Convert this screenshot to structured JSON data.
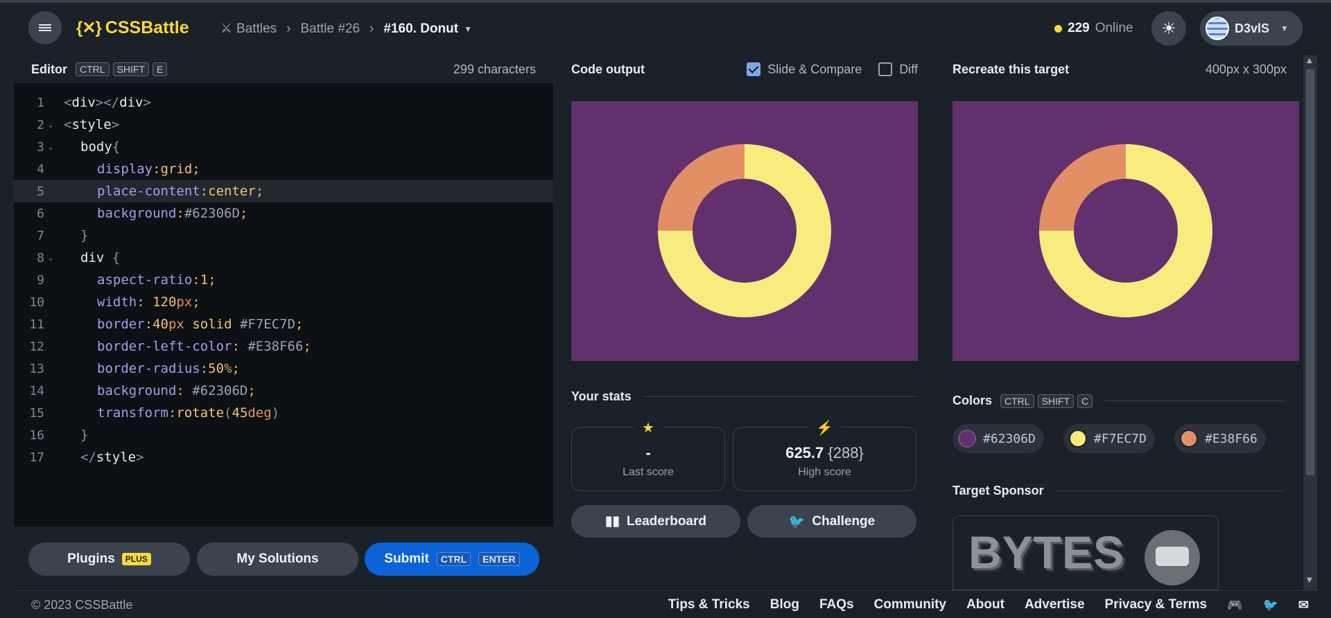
{
  "header": {
    "logo_icon": "{✕}",
    "logo_text": "CSSBattle",
    "breadcrumbs": [
      {
        "label": "Battles"
      },
      {
        "label": "Battle #26"
      },
      {
        "label": "#160. Donut"
      }
    ],
    "online_count": "229",
    "online_label": "Online",
    "username": "D3vlS"
  },
  "editor": {
    "title": "Editor",
    "shortcut": [
      "CTRL",
      "SHIFT",
      "E"
    ],
    "char_count": "299 characters",
    "lines": [
      {
        "n": "1",
        "fold": ""
      },
      {
        "n": "2",
        "fold": "⌄"
      },
      {
        "n": "3",
        "fold": "⌄"
      },
      {
        "n": "4",
        "fold": ""
      },
      {
        "n": "5",
        "fold": ""
      },
      {
        "n": "6",
        "fold": ""
      },
      {
        "n": "7",
        "fold": ""
      },
      {
        "n": "8",
        "fold": "⌄"
      },
      {
        "n": "9",
        "fold": ""
      },
      {
        "n": "10",
        "fold": ""
      },
      {
        "n": "11",
        "fold": ""
      },
      {
        "n": "12",
        "fold": ""
      },
      {
        "n": "13",
        "fold": ""
      },
      {
        "n": "14",
        "fold": ""
      },
      {
        "n": "15",
        "fold": ""
      },
      {
        "n": "16",
        "fold": ""
      },
      {
        "n": "17",
        "fold": ""
      }
    ],
    "code": {
      "l1": [
        "<",
        "div",
        "></",
        "div",
        ">"
      ],
      "l2": [
        "<",
        "style",
        ">"
      ],
      "l3": [
        "body",
        "{"
      ],
      "l4": [
        "display",
        ":",
        "grid",
        ";"
      ],
      "l5": [
        "place-content",
        ":",
        "center",
        ";"
      ],
      "l6": [
        "background",
        ":",
        "#62306D",
        ";"
      ],
      "l7": [
        "}"
      ],
      "l8": [
        "div",
        " {"
      ],
      "l9": [
        "aspect-ratio",
        ":",
        "1",
        ";"
      ],
      "l10": [
        "width",
        ": ",
        "120",
        "px",
        ";"
      ],
      "l11": [
        "border",
        ":",
        "40",
        "px",
        " solid ",
        "#F7EC7D",
        ";"
      ],
      "l12": [
        "border-left-color",
        ": ",
        "#E38F66",
        ";"
      ],
      "l13": [
        "border-radius",
        ":",
        "50",
        "%",
        ";"
      ],
      "l14": [
        "background",
        ": ",
        "#62306D",
        ";"
      ],
      "l15": [
        "transform",
        ":",
        "rotate",
        "(",
        "45",
        "deg",
        ")"
      ],
      "l16": [
        "}"
      ],
      "l17": [
        "</",
        "style",
        ">"
      ]
    },
    "plugins_label": "Plugins",
    "plugins_badge": "PLUS",
    "solutions_label": "My Solutions",
    "submit_label": "Submit",
    "submit_keys": [
      "CTRL",
      "ENTER"
    ]
  },
  "output": {
    "title": "Code output",
    "slide_compare_label": "Slide & Compare",
    "slide_compare_checked": true,
    "diff_label": "Diff",
    "diff_checked": false,
    "stats_title": "Your stats",
    "last_score_value": "-",
    "last_score_label": "Last score",
    "high_score_value": "625.7",
    "high_score_chars": "{288}",
    "high_score_label": "High score",
    "leaderboard_label": "Leaderboard",
    "challenge_label": "Challenge"
  },
  "target": {
    "title": "Recreate this target",
    "size": "400px x 300px",
    "colors_title": "Colors",
    "colors_keys": [
      "CTRL",
      "SHIFT",
      "C"
    ],
    "colors": [
      {
        "hex": "#62306D"
      },
      {
        "hex": "#F7EC7D"
      },
      {
        "hex": "#E38F66"
      }
    ],
    "sponsor_title": "Target Sponsor",
    "sponsor_text": "BYTES"
  },
  "footer": {
    "copyright": "© 2023 CSSBattle",
    "links": [
      "Tips & Tricks",
      "Blog",
      "FAQs",
      "Community",
      "About",
      "Advertise",
      "Privacy & Terms"
    ]
  },
  "colors": {
    "accent": "#f6d93b",
    "submit": "#0c63d8",
    "bg": "#1b2128",
    "editor_bg": "#0d1014",
    "canvas_bg": "#62306D",
    "donut_main": "#F7EC7D",
    "donut_left": "#E38F66"
  }
}
